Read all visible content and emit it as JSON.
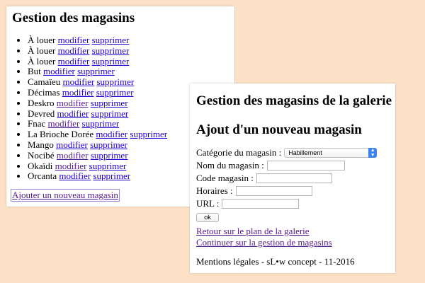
{
  "list_window": {
    "title": "Gestion des magasins",
    "shops": [
      {
        "name": "À louer",
        "edit": "modifier",
        "delete": "supprimer"
      },
      {
        "name": "À louer",
        "edit": "modifier",
        "delete": "supprimer"
      },
      {
        "name": "À louer",
        "edit": "modifier",
        "delete": "supprimer"
      },
      {
        "name": "But",
        "edit": "modifier",
        "delete": "supprimer"
      },
      {
        "name": "Camaïeu",
        "edit": "modifier",
        "delete": "supprimer"
      },
      {
        "name": "Décimas",
        "edit": "modifier",
        "delete": "supprimer"
      },
      {
        "name": "Deskro",
        "edit": "modifier",
        "delete": "supprimer"
      },
      {
        "name": "Devred",
        "edit": "modifier",
        "delete": "supprimer"
      },
      {
        "name": "Fnac",
        "edit": "modifier",
        "delete": "supprimer"
      },
      {
        "name": "La Brioche Dorée",
        "edit": "modifier",
        "delete": "supprimer"
      },
      {
        "name": "Mango",
        "edit": "modifier",
        "delete": "supprimer"
      },
      {
        "name": "Nocibé",
        "edit": "modifier",
        "delete": "supprimer"
      },
      {
        "name": "Okaïdi",
        "edit": "modifier",
        "delete": "supprimer"
      },
      {
        "name": "Orcanta",
        "edit": "modifier",
        "delete": "supprimer"
      }
    ],
    "add_link": "Ajouter un nouveau magasin"
  },
  "form_window": {
    "title": "Gestion des magasins de la galerie",
    "subtitle": "Ajout d'un nouveau magasin",
    "category_label": "Catégorie du magasin :",
    "category_value": "Habillement",
    "name_label": "Nom du magasin :",
    "code_label": "Code magasin :",
    "hours_label": "Horaires :",
    "url_label": "URL :",
    "ok_label": "ok",
    "back_link": "Retour sur le plan de la galerie",
    "continue_link": "Continuer sur la gestion de magasins",
    "footer": "Mentions légales - sL•w concept - 11-2016"
  },
  "colors": {
    "background": "#fde1c7",
    "link": "#1f00d4",
    "visited_link": "#551a8b",
    "select_arrow": "#3b82f6"
  },
  "icons": {
    "select_arrow": "up-down-chevron-icon"
  }
}
